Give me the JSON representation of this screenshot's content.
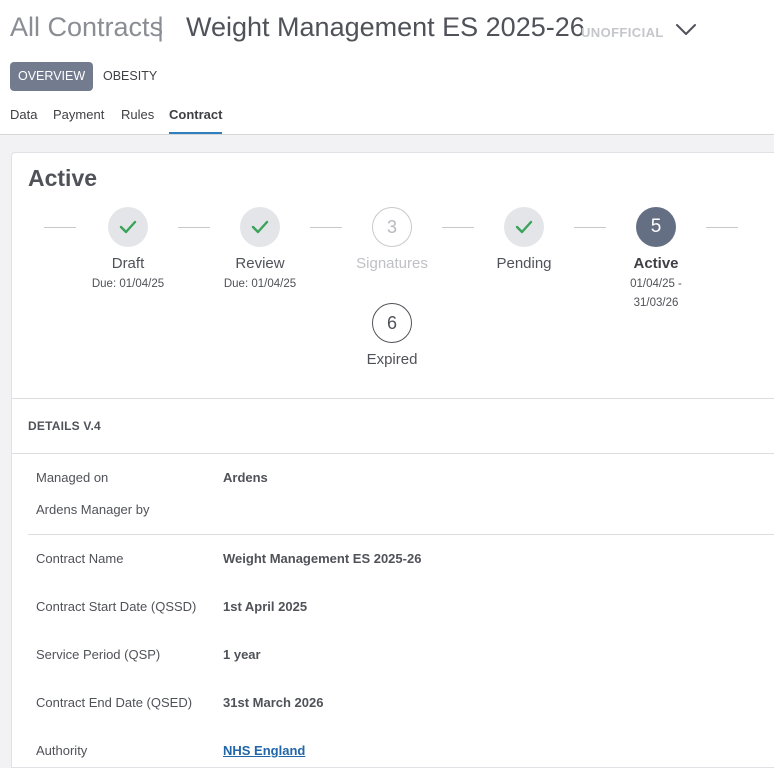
{
  "header": {
    "breadcrumb": "All Contracts",
    "separator": "|",
    "title": "Weight Management ES 2025-26",
    "status_badge": "UNOFFICIAL",
    "pills": [
      {
        "label": "OVERVIEW",
        "active": true
      },
      {
        "label": "OBESITY",
        "active": false
      }
    ],
    "tabs": [
      {
        "label": "Data",
        "active": false
      },
      {
        "label": "Payment",
        "active": false
      },
      {
        "label": "Rules",
        "active": false
      },
      {
        "label": "Contract",
        "active": true
      }
    ]
  },
  "status_card": {
    "title": "Active",
    "steps": [
      {
        "label": "Draft",
        "state": "done",
        "icon": "check-icon",
        "due": "Due: 01/04/25"
      },
      {
        "label": "Review",
        "state": "done",
        "icon": "check-icon",
        "due": "Due: 01/04/25"
      },
      {
        "label": "Signatures",
        "state": "todo",
        "number": "3",
        "due": ""
      },
      {
        "label": "Pending",
        "state": "done",
        "icon": "check-icon",
        "due": ""
      },
      {
        "label": "Active",
        "state": "current",
        "number": "5",
        "due_line1": "01/04/25 -",
        "due_line2": "31/03/26"
      },
      {
        "label": "Expired",
        "state": "upcoming",
        "number": "6",
        "due": ""
      }
    ]
  },
  "details": {
    "title": "DETAILS V.4",
    "rows": [
      {
        "label": "Managed on",
        "value": "Ardens"
      },
      {
        "label": "Ardens Manager by",
        "value": ""
      },
      {
        "label": "Contract Name",
        "value": "Weight Management ES 2025-26"
      },
      {
        "label": "Contract Start Date (QSSD)",
        "value": "1st April 2025"
      },
      {
        "label": "Service Period (QSP)",
        "value": "1 year"
      },
      {
        "label": "Contract End Date (QSED)",
        "value": "31st March 2026"
      },
      {
        "label": "Authority",
        "value": "NHS England",
        "link": true
      }
    ]
  },
  "colors": {
    "check": "#3aa35b",
    "accent_tab": "#2f7fbf",
    "current_step": "#646f83",
    "link": "#2166a8"
  }
}
